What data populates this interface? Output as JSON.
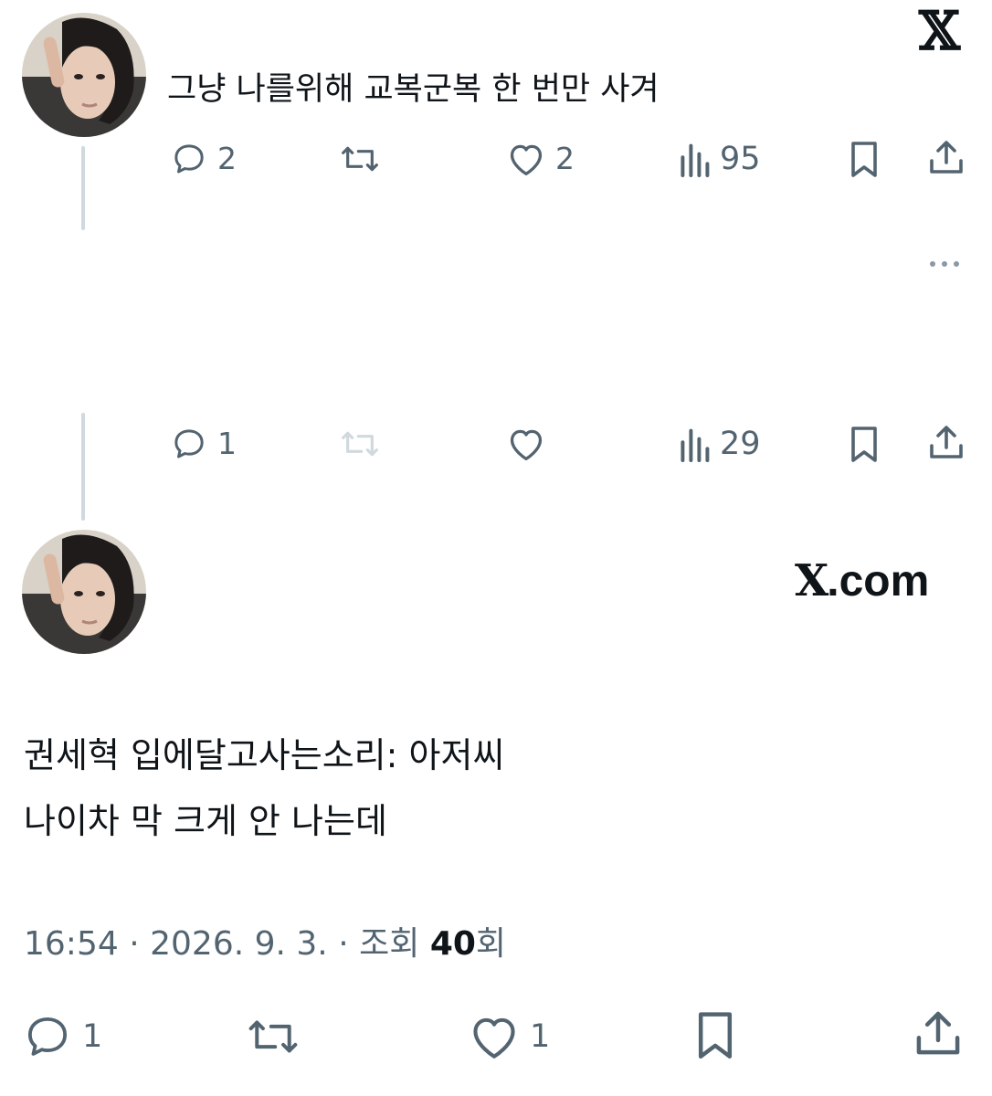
{
  "brand": {
    "logo_glyph": "𝕏",
    "site_label": "X.com",
    "site_suffix": ".com",
    "site_letter": "X"
  },
  "tweet1": {
    "text": "그냥 나를위해 교복군복 한 번만 사겨",
    "replies": "2",
    "reposts": "",
    "likes": "2",
    "views": "95"
  },
  "tweet2": {
    "text": "",
    "replies": "1",
    "reposts": "",
    "likes": "",
    "views": "29"
  },
  "main_tweet": {
    "line1": "권세혁 입에달고사는소리: 아저씨",
    "line2": "나이차 막 크게 안 나는데",
    "time": "16:54",
    "sep": "·",
    "date": "2026. 9. 3.",
    "views_prefix": "조회 ",
    "views_count": "40",
    "views_suffix": "회",
    "replies": "1",
    "likes": "1"
  },
  "icons": {
    "reply": "reply-icon",
    "repost": "repost-icon",
    "like": "heart-icon",
    "views": "views-icon",
    "bookmark": "bookmark-icon",
    "share": "share-icon",
    "more": "more-icon"
  },
  "colors": {
    "text": "#0f1419",
    "secondary": "#536471",
    "disabled": "#cfd9de",
    "thread": "#cfd9de"
  }
}
